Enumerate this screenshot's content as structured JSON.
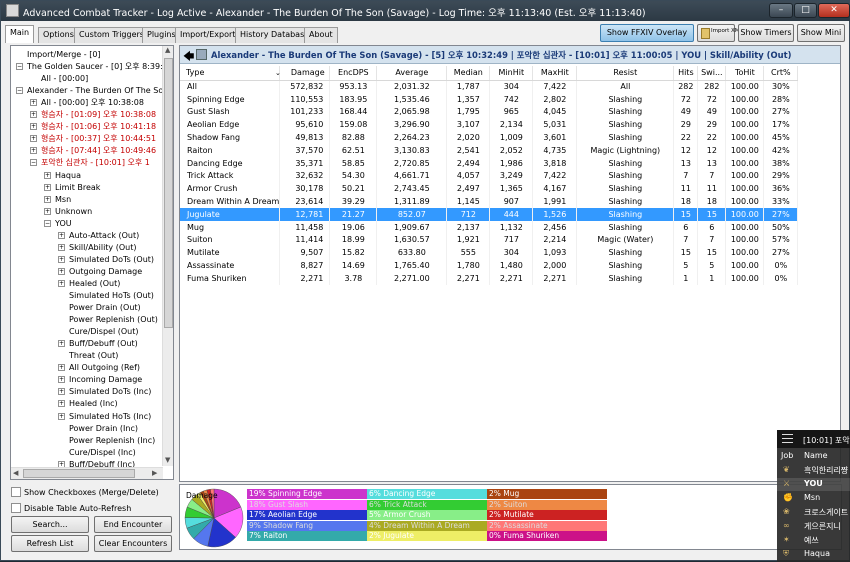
{
  "window": {
    "title": "Advanced Combat Tracker - Log Active - Alexander - The Burden Of The Son (Savage) - Log Time: 오후 11:13:40 (Est. 오후 11:13:40)"
  },
  "tabs": [
    "Main",
    "Options",
    "Custom Triggers",
    "Plugins",
    "Import/Export",
    "History Database",
    "About"
  ],
  "top_buttons": {
    "overlay": "Show FFXIV Overlay",
    "import_xml": "Import XML",
    "timers": "Show Timers",
    "mini": "Show Mini"
  },
  "tree": [
    {
      "label": "Import/Merge - [0]",
      "red": false
    },
    {
      "label": "The Golden Saucer - [0] 오후 8:39:5",
      "red": false
    },
    {
      "label": "All - [00:00]",
      "red": false
    },
    {
      "label": "Alexander - The Burden Of The Son",
      "red": false
    },
    {
      "label": "All - [00:00] 오후 10:38:08",
      "red": false
    },
    {
      "label": "형슴자 - [01:09] 오후 10:38:08",
      "red": true
    },
    {
      "label": "형슴자 - [01:06] 오후 10:41:18",
      "red": true
    },
    {
      "label": "형슴자 - [00:37] 오후 10:44:51",
      "red": true
    },
    {
      "label": "형슴자 - [07:44] 오후 10:49:46",
      "red": true
    },
    {
      "label": "포악한 십관자 - [10:01] 오후 1",
      "red": true
    },
    {
      "label": "Haqua",
      "red": false
    },
    {
      "label": "Limit Break",
      "red": false
    },
    {
      "label": "Msn",
      "red": false
    },
    {
      "label": "Unknown",
      "red": false
    },
    {
      "label": "YOU",
      "red": false
    },
    {
      "label": "Auto-Attack (Out)",
      "red": false
    },
    {
      "label": "Skill/Ability (Out)",
      "red": false
    },
    {
      "label": "Simulated DoTs (Out)",
      "red": false
    },
    {
      "label": "Outgoing Damage",
      "red": false
    },
    {
      "label": "Healed (Out)",
      "red": false
    },
    {
      "label": "Simulated HoTs (Out)",
      "red": false
    },
    {
      "label": "Power Drain (Out)",
      "red": false
    },
    {
      "label": "Power Replenish (Out)",
      "red": false
    },
    {
      "label": "Cure/Dispel (Out)",
      "red": false
    },
    {
      "label": "Buff/Debuff (Out)",
      "red": false
    },
    {
      "label": "Threat (Out)",
      "red": false
    },
    {
      "label": "All Outgoing (Ref)",
      "red": false
    },
    {
      "label": "Incoming Damage",
      "red": false
    },
    {
      "label": "Simulated DoTs (Inc)",
      "red": false
    },
    {
      "label": "Healed (Inc)",
      "red": false
    },
    {
      "label": "Simulated HoTs (Inc)",
      "red": false
    },
    {
      "label": "Power Drain (Inc)",
      "red": false
    },
    {
      "label": "Power Replenish (Inc)",
      "red": false
    },
    {
      "label": "Cure/Dispel (Inc)",
      "red": false
    },
    {
      "label": "Buff/Debuff (Inc)",
      "red": false
    }
  ],
  "options": {
    "show_checkboxes": "Show Checkboxes (Merge/Delete)",
    "disable_refresh": "Disable Table Auto-Refresh"
  },
  "left_buttons": {
    "search": "Search...",
    "end_encounter": "End Encounter",
    "refresh": "Refresh List",
    "clear": "Clear Encounters"
  },
  "encounter_title": "Alexander - The Burden Of The Son (Savage) - [5] 오후 10:32:49 | 포악한 십관자 - [10:01] 오후 11:00:05 | YOU | Skill/Ability (Out)",
  "table": {
    "columns": [
      "Type",
      "Damage",
      "EncDPS",
      "Average",
      "Median",
      "MinHit",
      "MaxHit",
      "Resist",
      "Hits",
      "Swi...",
      "ToHit",
      "Crt%"
    ],
    "sort_indicator": "⌄",
    "selected_row": 10,
    "rows": [
      [
        "All",
        "572,832",
        "953.13",
        "2,031.32",
        "1,787",
        "304",
        "7,422",
        "All",
        "282",
        "282",
        "100.00",
        "30%"
      ],
      [
        "Spinning Edge",
        "110,553",
        "183.95",
        "1,535.46",
        "1,357",
        "742",
        "2,802",
        "Slashing",
        "72",
        "72",
        "100.00",
        "28%"
      ],
      [
        "Gust Slash",
        "101,233",
        "168.44",
        "2,065.98",
        "1,795",
        "965",
        "4,045",
        "Slashing",
        "49",
        "49",
        "100.00",
        "27%"
      ],
      [
        "Aeolian Edge",
        "95,610",
        "159.08",
        "3,296.90",
        "3,107",
        "2,134",
        "5,031",
        "Slashing",
        "29",
        "29",
        "100.00",
        "17%"
      ],
      [
        "Shadow Fang",
        "49,813",
        "82.88",
        "2,264.23",
        "2,020",
        "1,009",
        "3,601",
        "Slashing",
        "22",
        "22",
        "100.00",
        "45%"
      ],
      [
        "Raiton",
        "37,570",
        "62.51",
        "3,130.83",
        "2,541",
        "2,052",
        "4,735",
        "Magic (Lightning)",
        "12",
        "12",
        "100.00",
        "42%"
      ],
      [
        "Dancing Edge",
        "35,371",
        "58.85",
        "2,720.85",
        "2,494",
        "1,986",
        "3,818",
        "Slashing",
        "13",
        "13",
        "100.00",
        "38%"
      ],
      [
        "Trick Attack",
        "32,632",
        "54.30",
        "4,661.71",
        "4,057",
        "3,249",
        "7,422",
        "Slashing",
        "7",
        "7",
        "100.00",
        "29%"
      ],
      [
        "Armor Crush",
        "30,178",
        "50.21",
        "2,743.45",
        "2,497",
        "1,365",
        "4,167",
        "Slashing",
        "11",
        "11",
        "100.00",
        "36%"
      ],
      [
        "Dream Within A Dream",
        "23,614",
        "39.29",
        "1,311.89",
        "1,145",
        "907",
        "1,991",
        "Slashing",
        "18",
        "18",
        "100.00",
        "33%"
      ],
      [
        "Jugulate",
        "12,781",
        "21.27",
        "852.07",
        "712",
        "444",
        "1,526",
        "Slashing",
        "15",
        "15",
        "100.00",
        "27%"
      ],
      [
        "Mug",
        "11,458",
        "19.06",
        "1,909.67",
        "2,137",
        "1,132",
        "2,456",
        "Slashing",
        "6",
        "6",
        "100.00",
        "50%"
      ],
      [
        "Suiton",
        "11,414",
        "18.99",
        "1,630.57",
        "1,921",
        "717",
        "2,214",
        "Magic (Water)",
        "7",
        "7",
        "100.00",
        "57%"
      ],
      [
        "Mutilate",
        "9,507",
        "15.82",
        "633.80",
        "555",
        "304",
        "1,093",
        "Slashing",
        "15",
        "15",
        "100.00",
        "27%"
      ],
      [
        "Assassinate",
        "8,827",
        "14.69",
        "1,765.40",
        "1,780",
        "1,480",
        "2,000",
        "Slashing",
        "5",
        "5",
        "100.00",
        "0%"
      ],
      [
        "Fuma Shuriken",
        "2,271",
        "3.78",
        "2,271.00",
        "2,271",
        "2,271",
        "2,271",
        "Slashing",
        "1",
        "1",
        "100.00",
        "0%"
      ]
    ]
  },
  "graph": {
    "label": "Damage",
    "slices": [
      {
        "pct": 19,
        "name": "Spinning Edge",
        "color": "#cc33cc"
      },
      {
        "pct": 18,
        "name": "Gust Slash",
        "color": "#ff66ff"
      },
      {
        "pct": 17,
        "name": "Aeolian Edge",
        "color": "#2233cc"
      },
      {
        "pct": 9,
        "name": "Shadow Fang",
        "color": "#5577ee"
      },
      {
        "pct": 7,
        "name": "Raiton",
        "color": "#33aaaa"
      },
      {
        "pct": 6,
        "name": "Dancing Edge",
        "color": "#55dddd"
      },
      {
        "pct": 6,
        "name": "Trick Attack",
        "color": "#33cc33"
      },
      {
        "pct": 5,
        "name": "Armor Crush",
        "color": "#88ee88"
      },
      {
        "pct": 4,
        "name": "Dream Within A Dream",
        "color": "#aaaa22"
      },
      {
        "pct": 2,
        "name": "Jugulate",
        "color": "#eeee66"
      },
      {
        "pct": 2,
        "name": "Mug",
        "color": "#aa4411"
      },
      {
        "pct": 2,
        "name": "Suiton",
        "color": "#ee8844"
      },
      {
        "pct": 2,
        "name": "Mutilate",
        "color": "#cc2222"
      },
      {
        "pct": 2,
        "name": "Assassinate",
        "color": "#ff7777"
      },
      {
        "pct": 0,
        "name": "Fuma Shuriken",
        "color": "#cc1188"
      }
    ],
    "legend": [
      "19% Spinning Edge",
      "18% Gust Slash",
      "17% Aeolian Edge",
      "9% Shadow Fang",
      "7% Raiton",
      "6% Dancing Edge",
      "6% Trick Attack",
      "5% Armor Crush",
      "4% Dream Within A Dream",
      "2% Jugulate",
      "2% Mug",
      "2% Suiton",
      "2% Mutilate",
      "2% Assassinate",
      "0% Fuma Shuriken"
    ]
  },
  "overlay": {
    "title": "[10:01] 포악",
    "job_header": "Job",
    "name_header": "Name",
    "rows": [
      "흑익한리리쨩",
      "YOU",
      "Msn",
      "크로스게이트",
      "게으른지니",
      "예쓰",
      "Haqua"
    ],
    "job_icons": [
      "bow-icon",
      "dagger-icon",
      "fist-icon",
      "scholar-icon",
      "summoner-icon",
      "whm-icon",
      "pld-icon"
    ]
  }
}
